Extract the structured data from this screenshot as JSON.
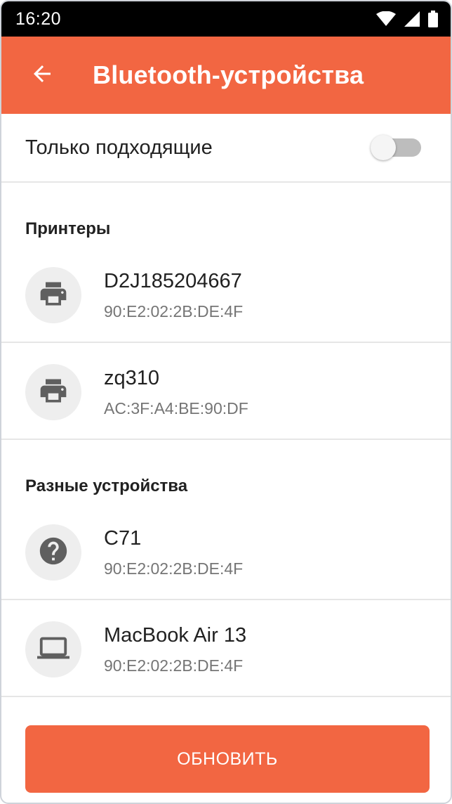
{
  "colors": {
    "accent": "#F26642",
    "icon_gray": "#5f5f5f"
  },
  "status_bar": {
    "time": "16:20",
    "icons": [
      "wifi-icon",
      "signal-icon",
      "battery-icon"
    ]
  },
  "app_bar": {
    "back_icon": "arrow-back-icon",
    "title": "Bluetooth-устройства"
  },
  "filter": {
    "label": "Только подходящие",
    "enabled": false
  },
  "sections": [
    {
      "title": "Принтеры",
      "devices": [
        {
          "name": "D2J185204667",
          "mac": "90:E2:02:2B:DE:4F",
          "icon": "printer-icon"
        },
        {
          "name": "zq310",
          "mac": "AC:3F:A4:BE:90:DF",
          "icon": "printer-icon"
        }
      ]
    },
    {
      "title": "Разные устройства",
      "devices": [
        {
          "name": "C71",
          "mac": "90:E2:02:2B:DE:4F",
          "icon": "help-icon"
        },
        {
          "name": "MacBook Air 13",
          "mac": "90:E2:02:2B:DE:4F",
          "icon": "laptop-icon"
        }
      ]
    }
  ],
  "actions": {
    "refresh_label": "ОБНОВИТЬ"
  }
}
